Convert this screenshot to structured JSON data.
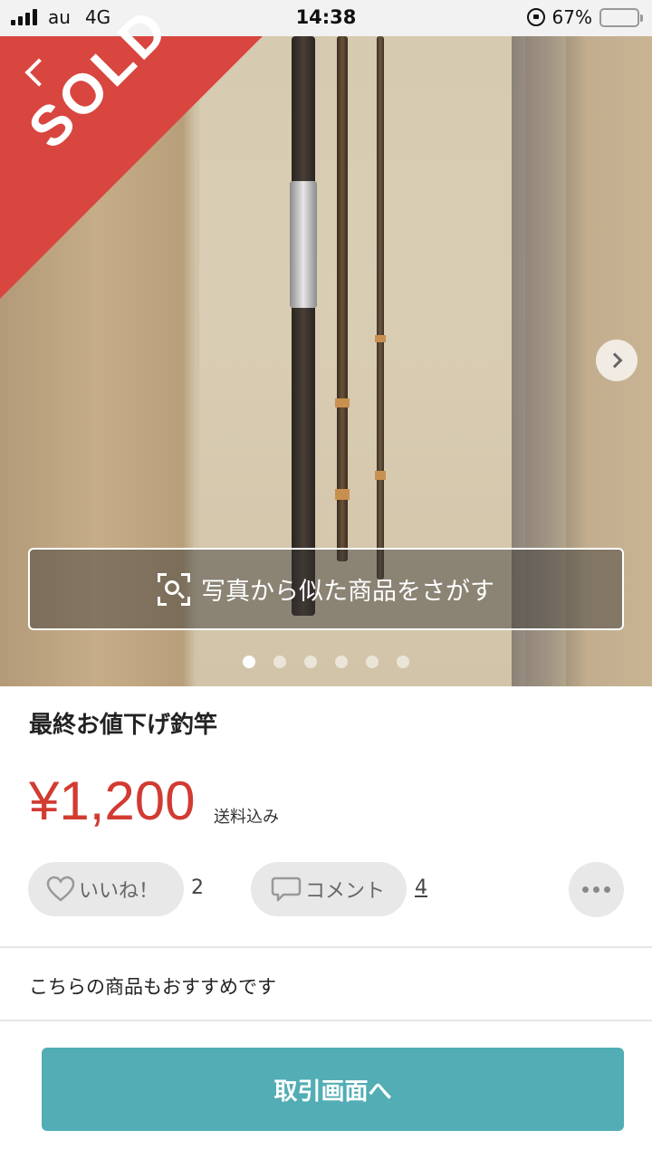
{
  "status_bar": {
    "carrier": "au",
    "network": "4G",
    "time": "14:38",
    "battery": "67%",
    "battery_level": 0.67
  },
  "photo": {
    "sold_label": "SOLD",
    "search_similar_label": "写真から似た商品をさがす",
    "page_count": 6,
    "current_page": 1
  },
  "item": {
    "title": "最終お値下げ釣竿",
    "price": "¥1,200",
    "shipping_note": "送料込み"
  },
  "actions": {
    "like_label": "いいね！",
    "like_count": "2",
    "comment_label": "コメント",
    "comment_count": "4"
  },
  "recommend_text": "こちらの商品もおすすめです",
  "cta_label": "取引画面へ",
  "colors": {
    "sold_red": "#d8463f",
    "price_red": "#d23b32",
    "cta_teal": "#52adb4"
  }
}
